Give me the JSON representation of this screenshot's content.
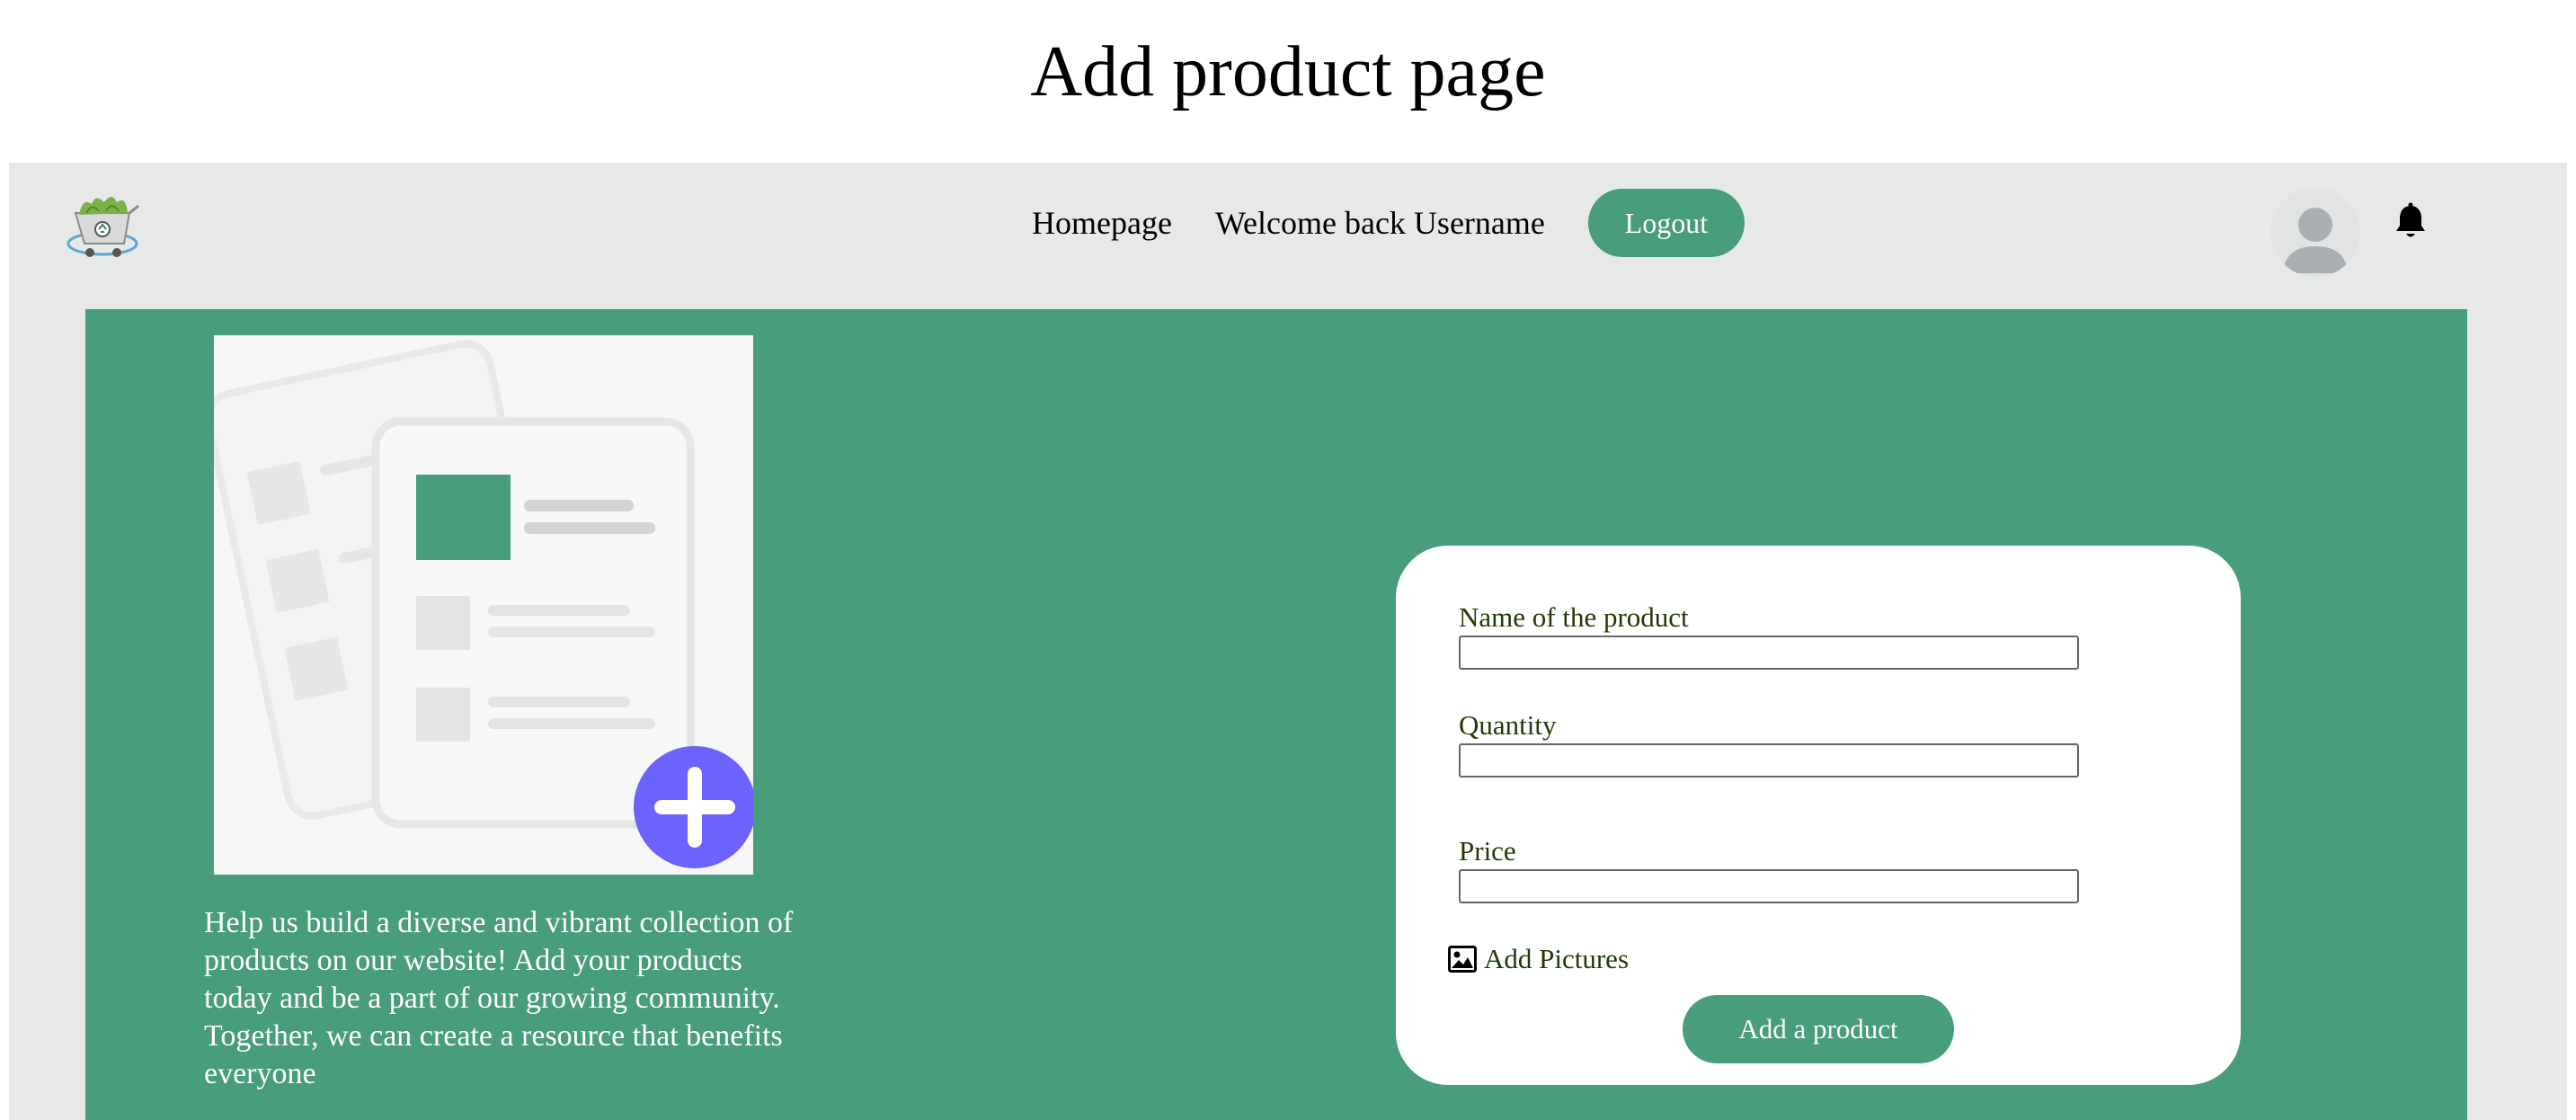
{
  "page": {
    "title": "Add product page"
  },
  "navbar": {
    "logo_icon": "recycle-cart-logo-icon",
    "homepage_label": "Homepage",
    "welcome_text": "Welcome back Username",
    "logout_label": "Logout",
    "avatar_icon": "user-avatar-icon",
    "bell_icon": "bell-icon"
  },
  "hero": {
    "illustration_icon": "add-document-illustration",
    "description": "Help us build a diverse and vibrant collection of products on our website! Add your products today and be a part of our growing community. Together, we can create a resource that benefits everyone"
  },
  "form": {
    "name_label": "Name of the product",
    "name_value": "",
    "quantity_label": "Quantity",
    "quantity_value": "",
    "price_label": "Price",
    "price_value": "",
    "add_pictures_icon": "image-icon",
    "add_pictures_label": "Add Pictures",
    "submit_label": "Add a product"
  },
  "colors": {
    "brand_green": "#489d7a",
    "frame_gray": "#e7e9e8",
    "accent_purple": "#6c63ff",
    "label_text": "#1f3a06"
  }
}
